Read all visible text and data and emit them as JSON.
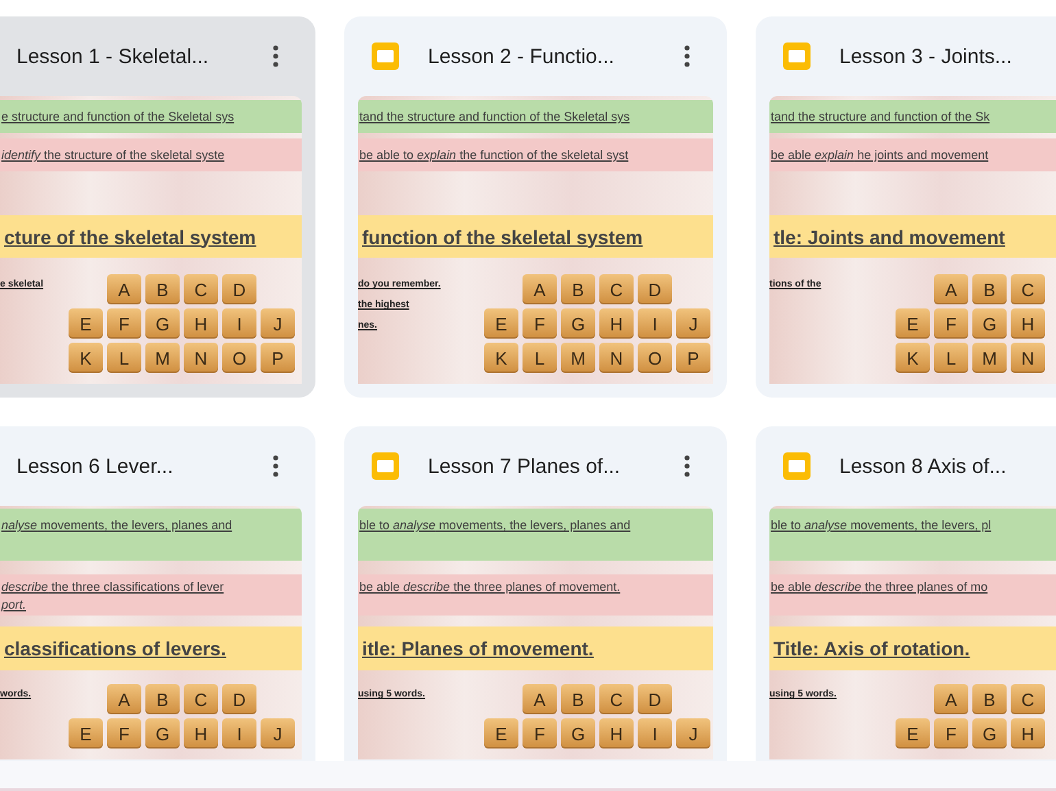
{
  "cards": [
    {
      "title": "Lesson 1 - Skeletal...",
      "selected": true,
      "file_icon": false,
      "menu": true,
      "slide": {
        "objective": "e structure and function of the Skeletal sys",
        "outcome": [
          "*identify* the structure of the skeletal syste"
        ],
        "heading": "cture of the skeletal system",
        "notes": [
          "e skeletal"
        ],
        "tiles": [
          [
            "A",
            "B",
            "C",
            "D"
          ],
          [
            "E",
            "F",
            "G",
            "H",
            "I",
            "J"
          ],
          [
            "K",
            "L",
            "M",
            "N",
            "O",
            "P"
          ]
        ]
      }
    },
    {
      "title": "Lesson 2 - Functio...",
      "selected": false,
      "file_icon": true,
      "menu": true,
      "slide": {
        "objective": "tand the structure and function of the Skeletal sys",
        "outcome": [
          "be able to *explain* the function of the skeletal syst"
        ],
        "heading": "function of the skeletal system",
        "notes": [
          "do you remember.",
          "the highest",
          "nes."
        ],
        "tiles": [
          [
            "A",
            "B",
            "C",
            "D"
          ],
          [
            "E",
            "F",
            "G",
            "H",
            "I",
            "J"
          ],
          [
            "K",
            "L",
            "M",
            "N",
            "O",
            "P"
          ]
        ]
      }
    },
    {
      "title": "Lesson 3 - Joints...",
      "selected": false,
      "file_icon": true,
      "menu": false,
      "slide": {
        "objective": "tand the structure and function of the Sk",
        "outcome": [
          "be able *explain* he joints and movement"
        ],
        "heading": "tle: Joints and movement",
        "notes": [
          "tions of the"
        ],
        "tiles": [
          [
            "A",
            "B",
            "C"
          ],
          [
            "E",
            "F",
            "G",
            "H"
          ],
          [
            "K",
            "L",
            "M",
            "N"
          ]
        ]
      }
    },
    {
      "title": "Lesson 6 Lever...",
      "selected": false,
      "file_icon": false,
      "menu": true,
      "slide": {
        "objective": "*nalyse* movements, the levers, planes and",
        "outcome": [
          "*describe* the three classifications of lever",
          "*port.*"
        ],
        "heading": "classifications of levers.",
        "notes": [
          "words."
        ],
        "tiles": [
          [
            "A",
            "B",
            "C",
            "D"
          ],
          [
            "E",
            "F",
            "G",
            "H",
            "I",
            "J"
          ]
        ]
      }
    },
    {
      "title": "Lesson 7 Planes of...",
      "selected": false,
      "file_icon": true,
      "menu": true,
      "slide": {
        "objective": "ble to *analyse* movements, the levers, planes and",
        "outcome": [
          "be able *describe* the three planes of movement."
        ],
        "heading": "itle: Planes of movement.",
        "notes": [
          "using 5 words."
        ],
        "tiles": [
          [
            "A",
            "B",
            "C",
            "D"
          ],
          [
            "E",
            "F",
            "G",
            "H",
            "I",
            "J"
          ]
        ]
      }
    },
    {
      "title": "Lesson 8 Axis of...",
      "selected": false,
      "file_icon": true,
      "menu": false,
      "slide": {
        "objective": "ble to *analyse* movements, the levers, pl",
        "outcome": [
          "be able *describe* the three planes of mo"
        ],
        "heading": "Title: Axis of rotation.",
        "notes": [
          "using 5 words."
        ],
        "tiles": [
          [
            "A",
            "B",
            "C"
          ],
          [
            "E",
            "F",
            "G",
            "H"
          ]
        ]
      }
    }
  ]
}
